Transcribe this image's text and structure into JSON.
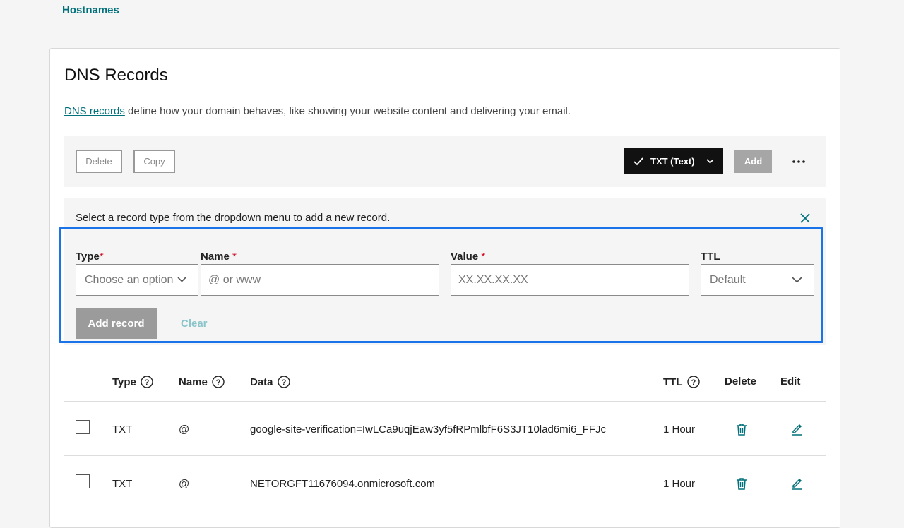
{
  "breadcrumb_link": "Hostnames",
  "section": {
    "title": "DNS Records",
    "description_link": "DNS records",
    "description_rest": " define how your domain behaves, like showing your website content and delivering your email."
  },
  "toolbar": {
    "delete_label": "Delete",
    "copy_label": "Copy",
    "record_type_selected": "TXT (Text)",
    "add_label": "Add"
  },
  "add_panel": {
    "info": "Select a record type from the dropdown menu to add a new record.",
    "type_label": "Type",
    "name_label": "Name",
    "value_label": "Value",
    "ttl_label": "TTL",
    "required_mark": "*",
    "type_placeholder": "Choose an option",
    "name_placeholder": "@ or www",
    "value_placeholder": "XX.XX.XX.XX",
    "ttl_value": "Default",
    "add_record_label": "Add record",
    "clear_label": "Clear"
  },
  "table": {
    "headers": {
      "type": "Type",
      "name": "Name",
      "data": "Data",
      "ttl": "TTL",
      "delete": "Delete",
      "edit": "Edit"
    },
    "rows": [
      {
        "type": "TXT",
        "name": "@",
        "data": "google-site-verification=IwLCa9uqjEaw3yf5fRPmlbfF6S3JT10lad6mi6_FFJc",
        "ttl": "1 Hour"
      },
      {
        "type": "TXT",
        "name": "@",
        "data": "NETORGFT11676094.onmicrosoft.com",
        "ttl": "1 Hour"
      }
    ]
  },
  "colors": {
    "link": "#00707a",
    "highlight": "#1a73e8",
    "required": "#d0021b"
  }
}
